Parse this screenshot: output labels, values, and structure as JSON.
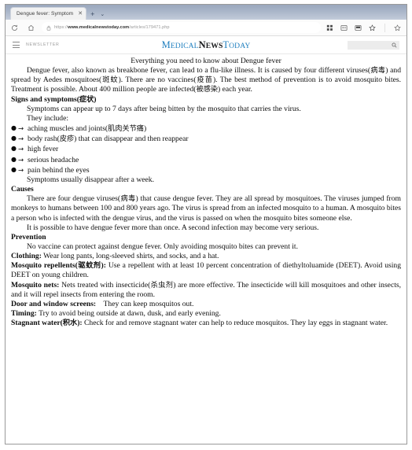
{
  "browser": {
    "tab": {
      "title": "Dengue fever: Symptom",
      "close_label": "✕"
    },
    "new_tab_label": "+",
    "tab_list_label": "⌄",
    "nav": {
      "reload_icon": "reload-icon",
      "home_icon": "home-icon",
      "lock_icon": "lock-icon",
      "url_scheme": "https://",
      "url_host": "www.medicalnewstoday.com",
      "url_path": "/articles/179471.php",
      "collections_icon": "collections-icon",
      "immersive_reader_icon": "immersive-reader-icon",
      "split_screen_icon": "split-screen-icon",
      "favorite_icon": "star-icon",
      "profile_icon": "star-outline-icon"
    }
  },
  "site": {
    "menu_icon": "hamburger-menu-icon",
    "newsletter_label": "NEWSLETTER",
    "logo": {
      "part1": "M",
      "part1_rest": "EDICAL",
      "part2": "N",
      "part2_rest": "EWS",
      "part3": "T",
      "part3_rest": "ODAY",
      "color_blue": "#1f7fbf",
      "color_black": "#17181a"
    },
    "search": {
      "value": "",
      "placeholder": "",
      "icon": "search-icon"
    }
  },
  "article": {
    "title": "Everything you need to know about Dengue fever",
    "intro": {
      "s1": "Dengue fever, also known as breakbone fever, can lead to a flu-like illness. It is caused by four different viruses(",
      "cjk1": "病毒",
      "s2": ") and spread by Aedes mosquitoes(",
      "cjk2": "斑蚊",
      "s3": "). There are no vaccines(",
      "cjk3": "疫苗",
      "s4": "). The best method of prevention is to avoid mosquito bites. Treatment is possible. About 400 million people are infected(",
      "cjk4": "被感染",
      "s5": ") each year."
    },
    "signs_heading": {
      "text": "Signs and symptoms(",
      "cjk": "症状",
      "tail": ")"
    },
    "signs_para": "Symptoms can appear up to 7 days after being bitten by the mosquito that carries the virus.",
    "they_include": "They include:",
    "bullets": [
      {
        "dot": "●",
        "arrow": "→",
        "text": "aching muscles and joints(",
        "cjk": "肌肉关节痛",
        "tail": ")"
      },
      {
        "dot": "●",
        "arrow": "→",
        "text": "body rash(",
        "cjk": "皮疹",
        "tail": ") that can disappear and then reappear"
      },
      {
        "dot": "●",
        "arrow": "→",
        "text": "high fever",
        "cjk": "",
        "tail": ""
      },
      {
        "dot": "●",
        "arrow": "→",
        "text": "serious headache",
        "cjk": "",
        "tail": ""
      },
      {
        "dot": "●",
        "arrow": "→",
        "text": "pain behind the eyes",
        "cjk": "",
        "tail": ""
      }
    ],
    "symptoms_disappear": "Symptoms usually disappear after a week.",
    "causes_heading": "Causes",
    "causes_para": {
      "s1": "There are four dengue viruses(",
      "cjk1": "病毒",
      "s2": ") that cause dengue fever. They are all spread by mosquitoes. The viruses jumped from monkeys to humans between 100 and 800 years ago. The virus is spread from an infected mosquito to a human. A mosquito bites a person who is infected with the dengue virus, and the virus is passed on when the mosquito bites someone else."
    },
    "causes_para2": "It is possible to have dengue fever more than once. A second infection may become very serious.",
    "prevention_heading": "Prevention",
    "prevention_para": "No vaccine can protect against dengue fever. Only avoiding mosquito bites can prevent it.",
    "tips": [
      {
        "term": "Clothing:",
        "term_cjk": "",
        "term_tail": "",
        "body": " Wear long pants, long-sleeved shirts, and socks, and a hat.",
        "body_cjk": "",
        "body_tail": ""
      },
      {
        "term": "Mosquito repellents(",
        "term_cjk": "驱蚊剂",
        "term_tail": "):",
        "body": " Use a repellent with at least 10 percent concentration of diethyltoluamide (DEET). Avoid using DEET on young children.",
        "body_cjk": "",
        "body_tail": ""
      },
      {
        "term": "Mosquito nets:",
        "term_cjk": "",
        "term_tail": "",
        "body": " Nets treated with insecticide(",
        "body_cjk": "杀虫剂",
        "body_tail": ") are more effective. The insecticide will kill mosquitoes and other insects, and it will repel insects from entering the room."
      },
      {
        "term": "Door and window screens:",
        "term_cjk": "",
        "term_tail": "",
        "body": "    They can keep mosquitos out.",
        "body_cjk": "",
        "body_tail": ""
      },
      {
        "term": "Timing:",
        "term_cjk": "",
        "term_tail": "",
        "body": " Try to avoid being outside at dawn, dusk, and early evening.",
        "body_cjk": "",
        "body_tail": ""
      },
      {
        "term": "Stagnant water(",
        "term_cjk": "积水",
        "term_tail": "):",
        "body": " Check for and remove stagnant water can help to reduce mosquitos. They lay eggs in stagnant water.",
        "body_cjk": "",
        "body_tail": ""
      }
    ]
  }
}
